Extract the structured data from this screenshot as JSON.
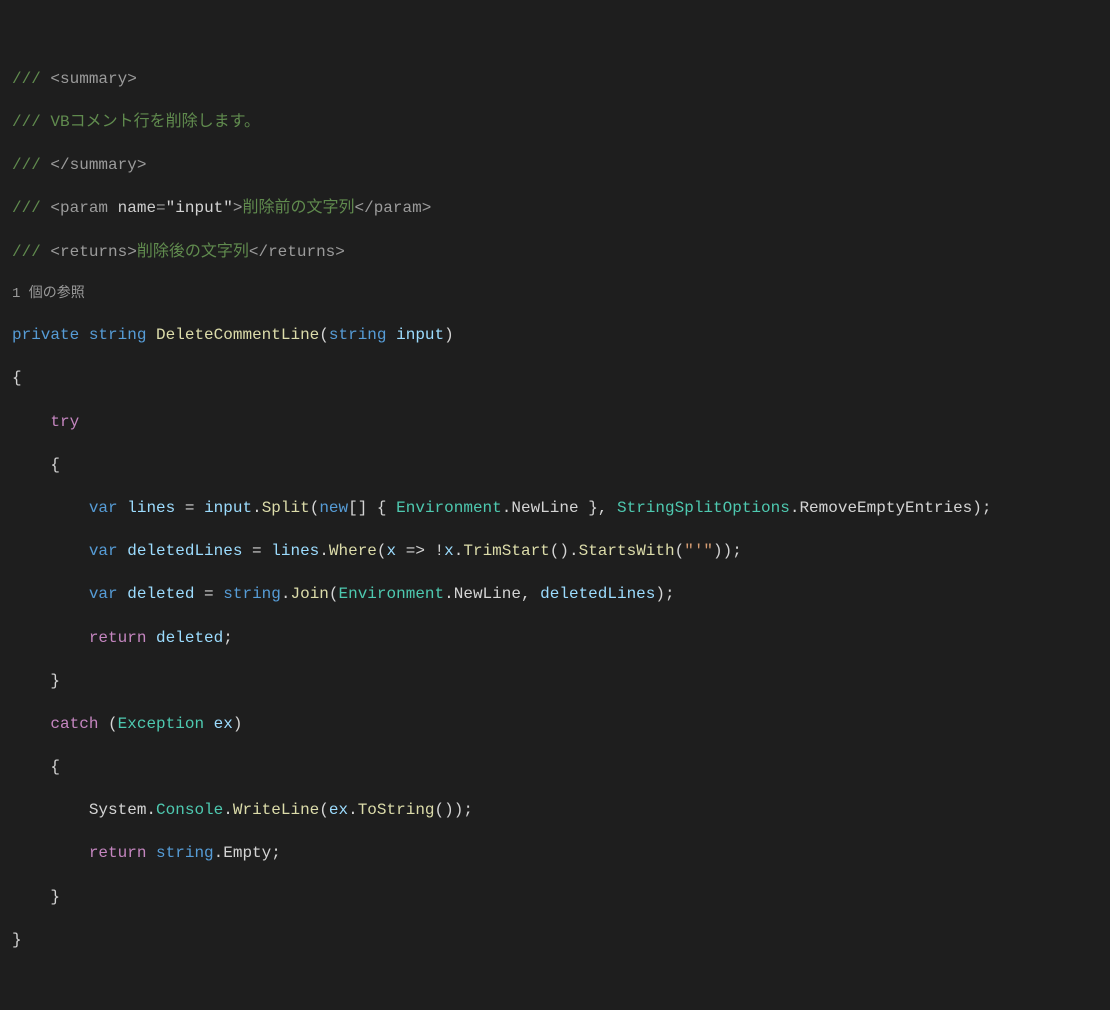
{
  "xmlDoc": {
    "slashes": "///",
    "summaryOpen": "<summary>",
    "summaryText": "VBコメント行を削除します。",
    "summaryClose": "</summary>",
    "paramOpen": "<param ",
    "paramAttrName": "name",
    "paramEq": "=",
    "paramAttrVal": "\"input\"",
    "paramClose": ">",
    "paramText": "削除前の文字列",
    "paramEnd": "</param>",
    "returnsOpen": "<returns>",
    "returnsText": "削除後の文字列",
    "returnsClose": "</returns>"
  },
  "codelens": "1 個の参照",
  "sig": {
    "private": "private",
    "string": "string",
    "methodName": "DeleteCommentLine",
    "lp": "(",
    "paramType": "string",
    "paramName": "input",
    "rp": ")"
  },
  "braces": {
    "open": "{",
    "close": "}"
  },
  "kw": {
    "try": "try",
    "var": "var",
    "new": "new",
    "return": "return",
    "catch": "catch",
    "string": "string"
  },
  "l1": {
    "lines": "lines",
    "eq": " = ",
    "input": "input",
    "dot": ".",
    "split": "Split",
    "lp": "(",
    "arr": "[] { ",
    "env": "Environment",
    "newline": "NewLine",
    "cb": " }, ",
    "sso": "StringSplitOptions",
    "ree": "RemoveEmptyEntries",
    "rp": ");"
  },
  "l2": {
    "deletedLines": "deletedLines",
    "eq": " = ",
    "lines": "lines",
    "dot": ".",
    "where": "Where",
    "lp": "(",
    "x": "x",
    "arrow": " => !",
    "x2": "x",
    "trim": "TrimStart",
    "paren": "().",
    "sw": "StartsWith",
    "str": "\"'\"",
    "rp": "));"
  },
  "l3": {
    "deleted": "deleted",
    "eq": " = ",
    "string": "string",
    "dot": ".",
    "join": "Join",
    "lp": "(",
    "env": "Environment",
    "newline": "NewLine",
    "comma": ", ",
    "dl": "deletedLines",
    "rp": ");"
  },
  "l4": {
    "deleted": "deleted",
    "semi": ";"
  },
  "catch": {
    "lp": "(",
    "exType": "Exception",
    "exName": "ex",
    "rp": ")"
  },
  "l5": {
    "system": "System",
    "dot": ".",
    "console": "Console",
    "wl": "WriteLine",
    "lp": "(",
    "ex": "ex",
    "ts": "ToString",
    "rp": "());"
  },
  "l6": {
    "string": "string",
    "dot": ".",
    "empty": "Empty",
    "semi": ";"
  },
  "indent": {
    "i1": "    ",
    "i2": "        "
  }
}
